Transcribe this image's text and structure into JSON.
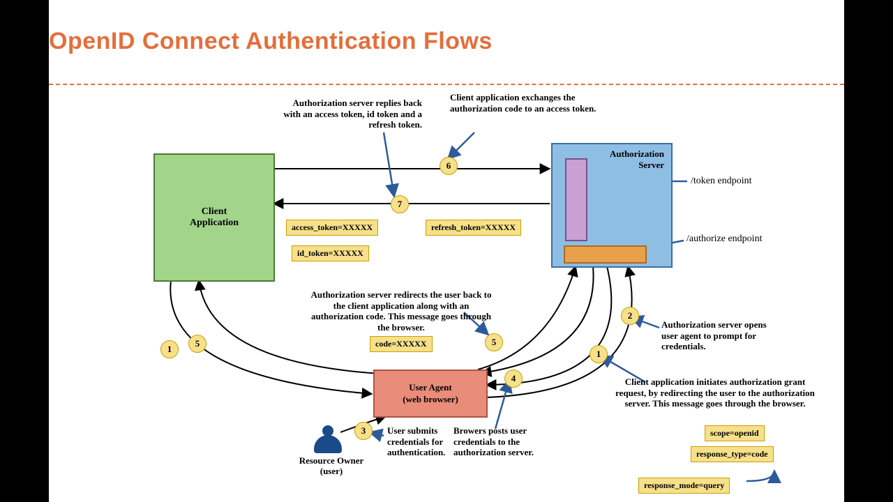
{
  "title": "OpenID Connect Authentication Flows",
  "components": {
    "client_application": "Client\nApplication",
    "authorization_server": "Authorization\nServer",
    "user_agent": "User Agent\n(web browser)",
    "resource_owner": "Resource Owner\n(user)"
  },
  "endpoints": {
    "token": "/token endpoint",
    "authorize": "/authorize endpoint"
  },
  "steps": {
    "1": {
      "num": "1",
      "note": "Client application initiates authorization grant request, by redirecting the user to the authorization server. This message goes through the browser."
    },
    "2": {
      "num": "2",
      "note": "Authorization server opens user agent to prompt for  credentials."
    },
    "3": {
      "num": "3",
      "note": "User submits credentials for authentication."
    },
    "4": {
      "num": "4",
      "note": "Browers posts user credentials to the authorization server."
    },
    "5": {
      "num": "5",
      "note": "Authorization server redirects the user back to the client application along with an authorization code. This message goes through the browser."
    },
    "6": {
      "num": "6",
      "note": "Client application exchanges the authorization code to an access token."
    },
    "7": {
      "num": "7",
      "note": "Authorization server replies back with an access token, id token and a refresh token."
    }
  },
  "params": {
    "scope": "scope=openid",
    "response_type": "response_type=code",
    "response_mode": "response_mode=query",
    "code": "code=XXXXX",
    "access_token": "access_token=XXXXX",
    "id_token": "id_token=XXXXX",
    "refresh_token": "refresh_token=XXXXX"
  }
}
